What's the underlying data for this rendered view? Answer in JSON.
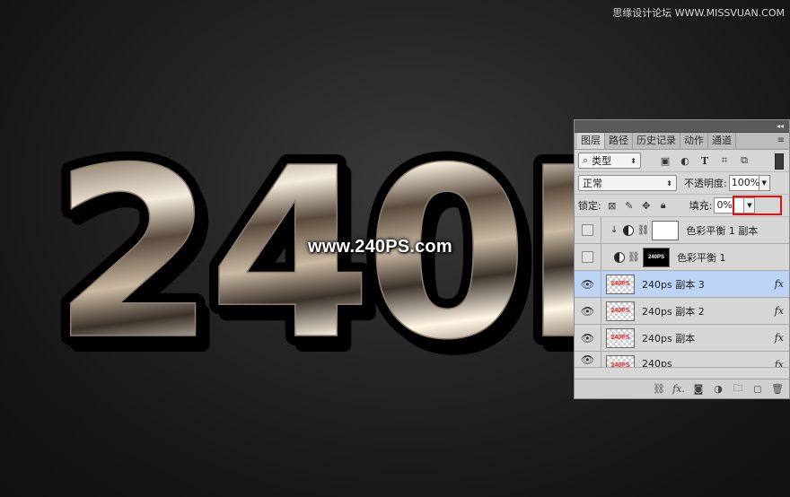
{
  "watermark": "思缘设计论坛  WWW.MISSVUAN.COM",
  "artwork": {
    "text": "240P",
    "site_label": "www.240PS.com",
    "colors": {
      "background": "#1c1c1c",
      "metal_light": "#f2ead8",
      "metal_dark": "#4a3e33",
      "gold": "#e7b20c",
      "outline": "#000000"
    }
  },
  "panel": {
    "tabs": [
      "图层",
      "路径",
      "历史记录",
      "动作",
      "通道"
    ],
    "active_tab": "图层",
    "filter": {
      "type_label": "类型"
    },
    "blend_mode": "正常",
    "opacity_label": "不透明度:",
    "opacity_value": "100%",
    "lock_label": "锁定:",
    "fill_label": "填充:",
    "fill_value": "0%",
    "layers": [
      {
        "name": "色彩平衡 1 副本",
        "kind": "adjustment",
        "visible": false,
        "clipped": true,
        "mask_text": ""
      },
      {
        "name": "色彩平衡 1",
        "kind": "adjustment",
        "visible": false,
        "clipped": false,
        "mask_text": "240PS"
      },
      {
        "name": "240ps 副本 3",
        "kind": "text",
        "visible": true,
        "selected": true,
        "fx": "fx",
        "thumb_text": "240PS"
      },
      {
        "name": "240ps 副本 2",
        "kind": "text",
        "visible": true,
        "fx": "fx",
        "thumb_text": "240PS"
      },
      {
        "name": "240ps 副本",
        "kind": "text",
        "visible": true,
        "fx": "fx",
        "thumb_text": "240PS"
      },
      {
        "name": "240ps",
        "kind": "text",
        "visible": true,
        "fx": "fx",
        "thumb_text": "240PS"
      }
    ],
    "bottom_icons": [
      "link-icon",
      "fx-icon",
      "mask-icon",
      "adjustment-icon",
      "folder-icon",
      "new-layer-icon",
      "trash-icon"
    ],
    "highlight_color": "#e01010",
    "selected_color": "#bcd3f6"
  }
}
